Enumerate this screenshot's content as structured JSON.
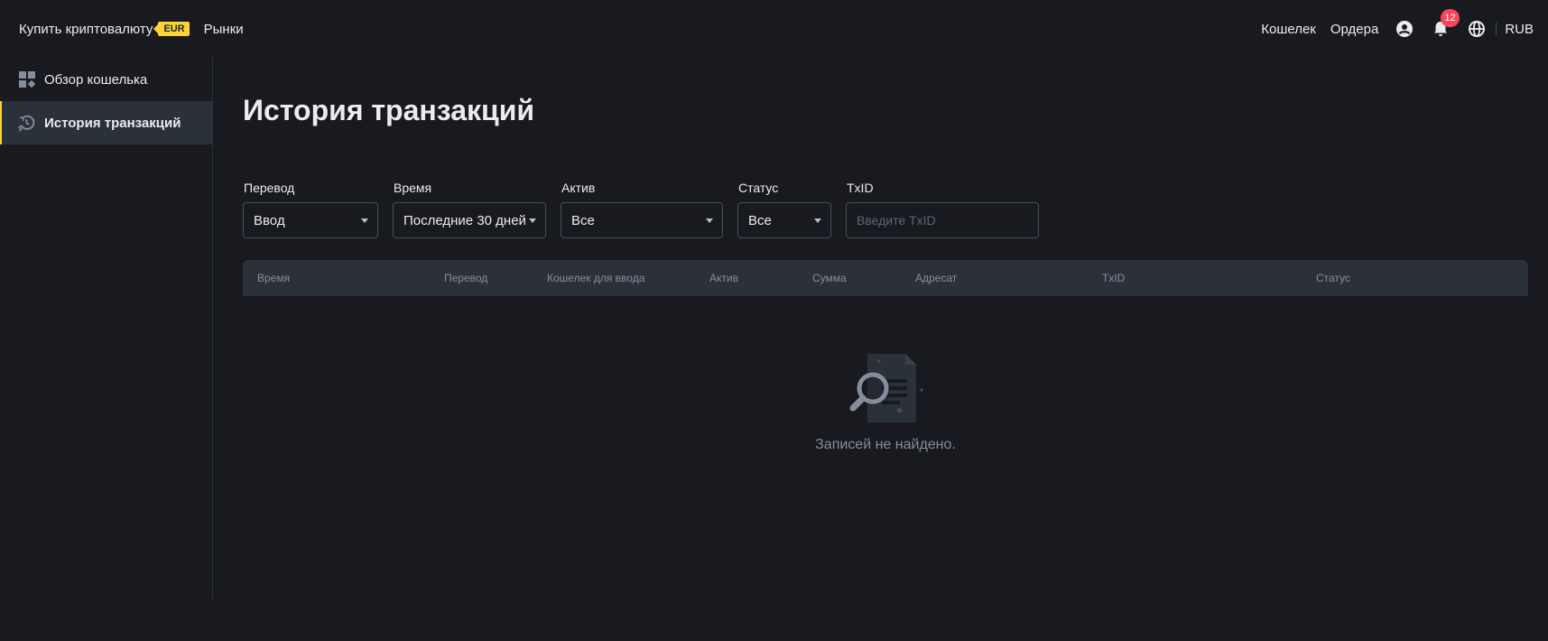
{
  "header": {
    "buy_crypto": "Купить криптовалюту",
    "buy_badge": "EUR",
    "markets": "Рынки",
    "wallet": "Кошелек",
    "orders": "Ордера",
    "notifications_count": "12",
    "currency": "RUB",
    "icons": [
      "user-icon",
      "bell-icon",
      "globe-icon"
    ]
  },
  "sidebar": {
    "items": [
      {
        "label": "Обзор кошелька",
        "icon": "dashboard-icon",
        "active": false
      },
      {
        "label": "История транзакций",
        "icon": "history-icon",
        "active": true
      }
    ]
  },
  "main": {
    "title": "История транзакций",
    "filters": {
      "transfer": {
        "label": "Перевод",
        "value": "Ввод"
      },
      "time": {
        "label": "Время",
        "value": "Последние 30 дней"
      },
      "asset": {
        "label": "Актив",
        "value": "Все"
      },
      "status": {
        "label": "Статус",
        "value": "Все"
      },
      "txid": {
        "label": "TxID",
        "placeholder": "Введите TxID"
      }
    },
    "table": {
      "columns": [
        "Время",
        "Перевод",
        "Кошелек для ввода",
        "Актив",
        "Сумма",
        "Адресат",
        "TxID",
        "Статус"
      ]
    },
    "empty_text": "Записей не найдено."
  },
  "colors": {
    "background": "#181a20",
    "panel": "#2b3139",
    "accent": "#fcd535",
    "notification": "#f6465d",
    "muted_text": "#848e9c"
  }
}
